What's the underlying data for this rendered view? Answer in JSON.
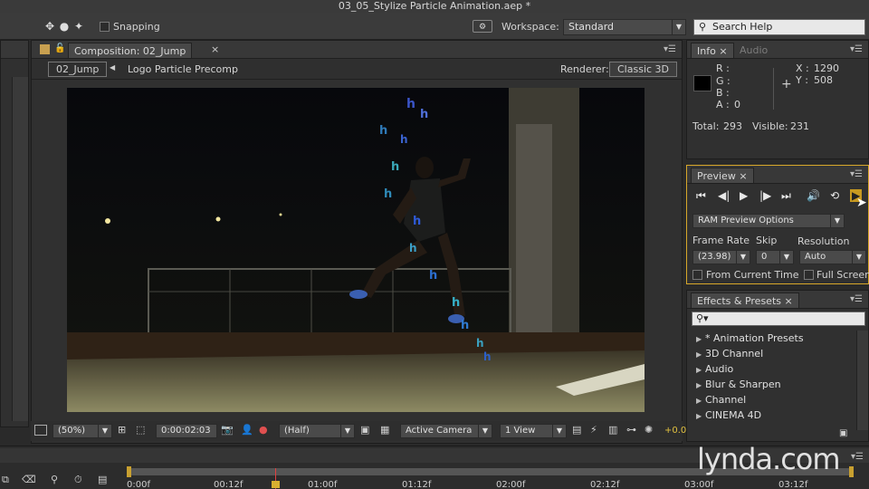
{
  "app": {
    "title": "03_05_Stylize Particle Animation.aep *"
  },
  "toolbar": {
    "snapping_label": "Snapping",
    "workspace_label": "Workspace:",
    "workspace_value": "Standard",
    "search_placeholder": "Search Help"
  },
  "composition": {
    "tab_label": "Composition: 02_Jump",
    "breadcrumb_current": "02_Jump",
    "breadcrumb_parent": "Logo Particle Precomp",
    "renderer_label": "Renderer:",
    "renderer_value": "Classic 3D",
    "zoom": "(50%)",
    "timecode": "0:00:02:03",
    "resolution": "(Half)",
    "camera": "Active Camera",
    "views": "1 View",
    "exposure": "+0.0"
  },
  "info": {
    "tab_info": "Info",
    "tab_audio": "Audio",
    "r_label": "R :",
    "g_label": "G :",
    "b_label": "B :",
    "a_label": "A :",
    "a_value": "0",
    "x_label": "X :",
    "x_value": "1290",
    "y_label": "Y :",
    "y_value": "508",
    "total_label": "Total:",
    "total_value": "293",
    "visible_label": "Visible:",
    "visible_value": "231"
  },
  "preview": {
    "tab_label": "Preview",
    "ram_options": "RAM Preview Options",
    "frame_rate_label": "Frame Rate",
    "frame_rate_value": "(23.98)",
    "skip_label": "Skip",
    "skip_value": "0",
    "resolution_label": "Resolution",
    "resolution_value": "Auto",
    "from_current_label": "From Current Time",
    "full_screen_label": "Full Screen"
  },
  "effects": {
    "tab_label": "Effects & Presets",
    "search_icon_glyph": "⚲▾",
    "items": [
      {
        "label": "* Animation Presets"
      },
      {
        "label": "3D Channel"
      },
      {
        "label": "Audio"
      },
      {
        "label": "Blur & Sharpen"
      },
      {
        "label": "Channel"
      },
      {
        "label": "CINEMA 4D"
      }
    ]
  },
  "timeline": {
    "ticks": [
      "0:00f",
      "00:12f",
      "01:00f",
      "01:12f",
      "02:00f",
      "02:12f",
      "03:00f",
      "03:12f"
    ],
    "watermark": "lynda.com"
  }
}
